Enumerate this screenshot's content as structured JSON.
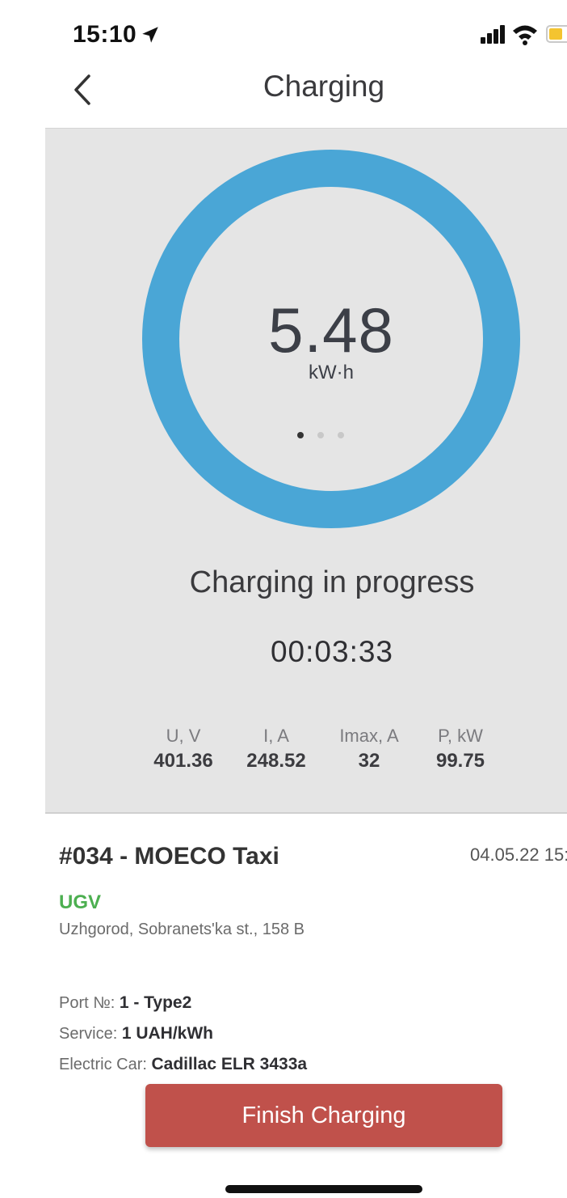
{
  "status_bar": {
    "time": "15:10"
  },
  "nav": {
    "title": "Charging"
  },
  "meter": {
    "energy": "5.48",
    "unit": "kW·h",
    "status": "Charging in progress",
    "elapsed": "00:03:33",
    "ring_color": "#4aa6d6",
    "pages": 3,
    "active_page": 1
  },
  "metrics": [
    {
      "label": "U,  V",
      "value": "401.36"
    },
    {
      "label": "I,  A",
      "value": "248.52"
    },
    {
      "label": "Imax,  A",
      "value": "32"
    },
    {
      "label": "P,  kW",
      "value": "99.75"
    }
  ],
  "station": {
    "id": "#034 - MOECO Taxi",
    "date": "04.05.22 15:",
    "operator": "UGV",
    "operator_color": "#4caf50",
    "address": "Uzhgorod, Sobranets'ka st., 158 B"
  },
  "details": {
    "port_label": "Port №:",
    "port_value": "1 - Type2",
    "service_label": "Service:",
    "service_value": "1 UAH/kWh",
    "car_label": "Electric Car:",
    "car_value": "Cadillac ELR 3433a"
  },
  "actions": {
    "finish_label": "Finish Charging",
    "finish_color": "#c0514b"
  }
}
